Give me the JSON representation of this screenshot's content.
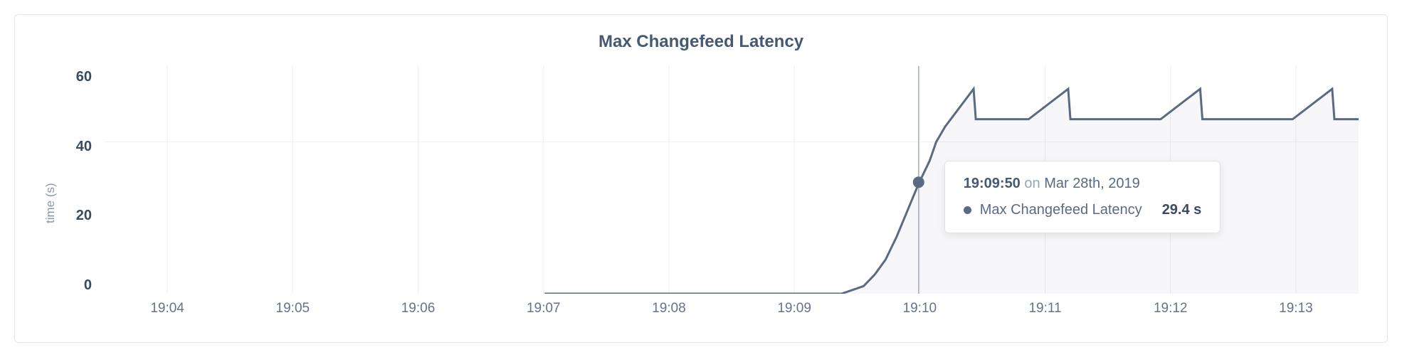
{
  "chart_data": {
    "type": "line",
    "title": "Max Changefeed Latency",
    "ylabel": "time (s)",
    "xlabel": "",
    "ylim": [
      0,
      60
    ],
    "y_ticks": [
      60,
      40,
      20,
      0
    ],
    "x_ticks": [
      "19:04",
      "19:05",
      "19:06",
      "19:07",
      "19:08",
      "19:09",
      "19:10",
      "19:11",
      "19:12",
      "19:13"
    ],
    "x_range_seconds": [
      0,
      570
    ],
    "series": [
      {
        "name": "Max Changefeed Latency",
        "x_seconds": [
          200,
          335,
          345,
          350,
          355,
          360,
          365,
          370,
          375,
          378,
          382,
          395,
          396,
          420,
          438,
          439,
          460,
          480,
          498,
          499,
          520,
          540,
          558,
          559,
          570
        ],
        "values": [
          0,
          0,
          2,
          5,
          9,
          15,
          22,
          29,
          35,
          40,
          44,
          54,
          46,
          46,
          54,
          46,
          46,
          46,
          54,
          46,
          46,
          46,
          54,
          46,
          46
        ]
      }
    ],
    "hover": {
      "time": "19:09:50",
      "date": "Mar 28th, 2019",
      "on_text": "on",
      "series_name": "Max Changefeed Latency",
      "value": "29.4 s",
      "x_seconds": 370,
      "y_value": 29.4
    }
  }
}
